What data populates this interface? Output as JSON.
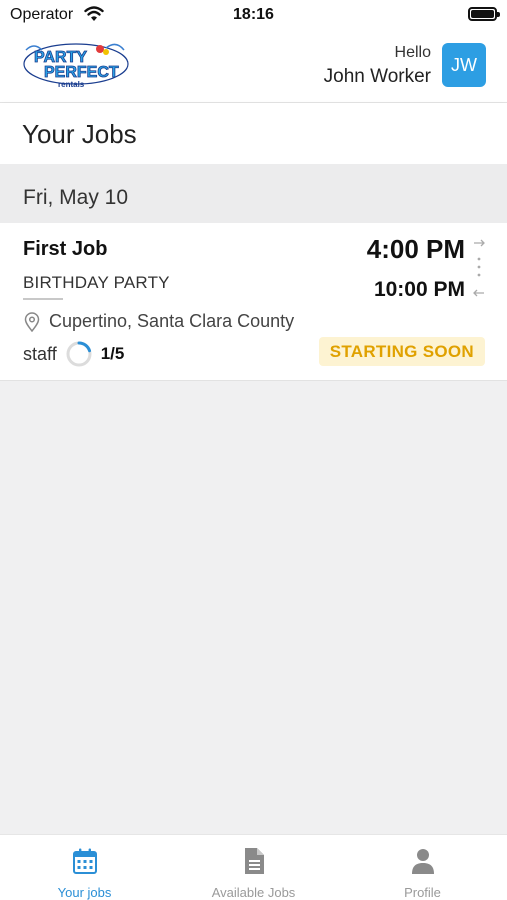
{
  "status_bar": {
    "carrier": "Operator",
    "time": "18:16"
  },
  "header": {
    "logo_alt": "Party Perfect rentals",
    "greeting": "Hello",
    "user_name": "John Worker",
    "avatar_initials": "JW"
  },
  "page": {
    "title": "Your Jobs"
  },
  "jobs_list": {
    "date": "Fri, May 10",
    "jobs": [
      {
        "title": "First Job",
        "type": "BIRTHDAY PARTY",
        "location": "Cupertino, Santa Clara County",
        "staff_label": "staff",
        "staff_count": "1/5",
        "staff_fraction": 0.2,
        "start_time": "4:00 PM",
        "end_time": "10:00 PM",
        "status": "STARTING SOON"
      }
    ]
  },
  "tab_bar": {
    "tabs": [
      {
        "label": "Your jobs",
        "icon": "calendar-icon",
        "active": true
      },
      {
        "label": "Available Jobs",
        "icon": "document-icon",
        "active": false
      },
      {
        "label": "Profile",
        "icon": "person-icon",
        "active": false
      }
    ]
  },
  "colors": {
    "accent": "#2b8fd6",
    "avatar_bg": "#2d9ee3",
    "badge_bg": "#fdf3d2",
    "badge_text": "#e0a100"
  }
}
